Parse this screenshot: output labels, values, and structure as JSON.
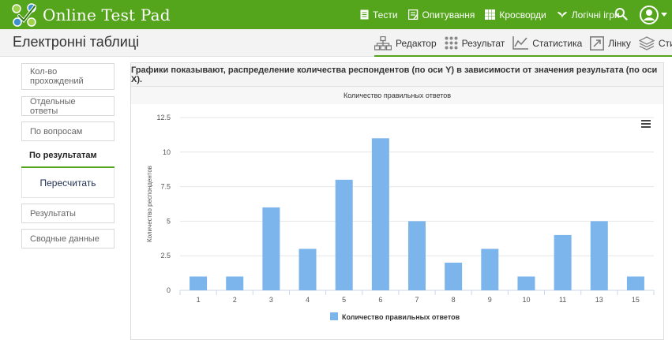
{
  "app": {
    "name": "Online Test Pad"
  },
  "topnav": [
    {
      "label": "Тести",
      "icon": "document-icon"
    },
    {
      "label": "Опитування",
      "icon": "survey-icon"
    },
    {
      "label": "Кросворди",
      "icon": "crossword-icon"
    },
    {
      "label": "Логічні ігри",
      "icon": "puzzle-icon"
    }
  ],
  "page": {
    "title": "Електронні таблиці"
  },
  "subnav": [
    {
      "label": "Редактор",
      "icon": "structure-icon"
    },
    {
      "label": "Результат",
      "icon": "dots-grid-icon"
    },
    {
      "label": "Статистика",
      "icon": "line-chart-icon"
    },
    {
      "label": "Лінку",
      "icon": "link-icon"
    },
    {
      "label": "Стили",
      "icon": "layers-icon"
    }
  ],
  "sidebar": {
    "items": [
      {
        "label": "Кол-во прохождений"
      },
      {
        "label": "Отдельные ответы"
      },
      {
        "label": "По вопросам"
      },
      {
        "label": "По результатам",
        "active": true
      },
      {
        "label": "Результаты"
      },
      {
        "label": "Сводные данные"
      }
    ],
    "recalc_label": "Пересчитать"
  },
  "panel": {
    "heading": "Графики показывают, распределение количества респондентов (по оси Y) в зависимости от значения результата (по оси X).",
    "menu_icon": "hamburger-icon"
  },
  "colors": {
    "brand": "#54a41c",
    "bar": "#7cb5ec"
  },
  "chart_data": {
    "type": "bar",
    "title": "Количество правильных ответов",
    "categories": [
      "1",
      "2",
      "3",
      "4",
      "5",
      "6",
      "7",
      "8",
      "9",
      "10",
      "11",
      "13",
      "15"
    ],
    "series": [
      {
        "name": "Количество правильных ответов",
        "values": [
          1,
          1,
          6,
          3,
          8,
          11,
          5,
          2,
          3,
          1,
          4,
          5,
          1
        ]
      }
    ],
    "ylabel": "Количество респондентов",
    "xlabel": "",
    "ylim": [
      0,
      12.5
    ],
    "yticks": [
      "0",
      "2.5",
      "5",
      "7.5",
      "10",
      "12.5"
    ],
    "grid": true,
    "legend": "bottom-center"
  }
}
